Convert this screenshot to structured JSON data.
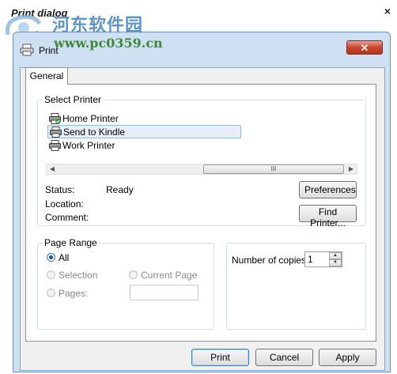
{
  "app": {
    "title": "Print dialog",
    "close_glyph": "×"
  },
  "watermark": {
    "name": "河东软件园",
    "url": "www.pc0359.cn"
  },
  "dialog": {
    "title": "Print",
    "close_glyph": "✕",
    "tabs": [
      {
        "label": "General",
        "active": true
      }
    ]
  },
  "select_printer": {
    "label": "Select Printer",
    "printers": [
      {
        "name": "Home Printer",
        "default": true
      },
      {
        "name": "Send to Kindle",
        "selected": true
      },
      {
        "name": "Work Printer"
      }
    ],
    "scrollbar": {
      "left_glyph": "◀",
      "right_glyph": "▶",
      "thumb_glyph": "III"
    },
    "status_label": "Status:",
    "status_value": "Ready",
    "location_label": "Location:",
    "comment_label": "Comment:",
    "preferences_button": "Preferences",
    "find_printer_button": "Find Printer..."
  },
  "page_range": {
    "label": "Page Range",
    "options": {
      "all": "All",
      "selection": "Selection",
      "current_page": "Current Page",
      "pages": "Pages:"
    },
    "selected": "all",
    "pages_value": ""
  },
  "copies": {
    "label": "Number of copies:",
    "value": "1",
    "up_glyph": "▲",
    "down_glyph": "▼"
  },
  "buttons": {
    "print": "Print",
    "cancel": "Cancel",
    "apply": "Apply"
  },
  "colors": {
    "titlebar": "#cfe0f3",
    "close_red": "#c9442b",
    "selection": "#e7f0fa",
    "default_border": "#3c7fb1"
  }
}
